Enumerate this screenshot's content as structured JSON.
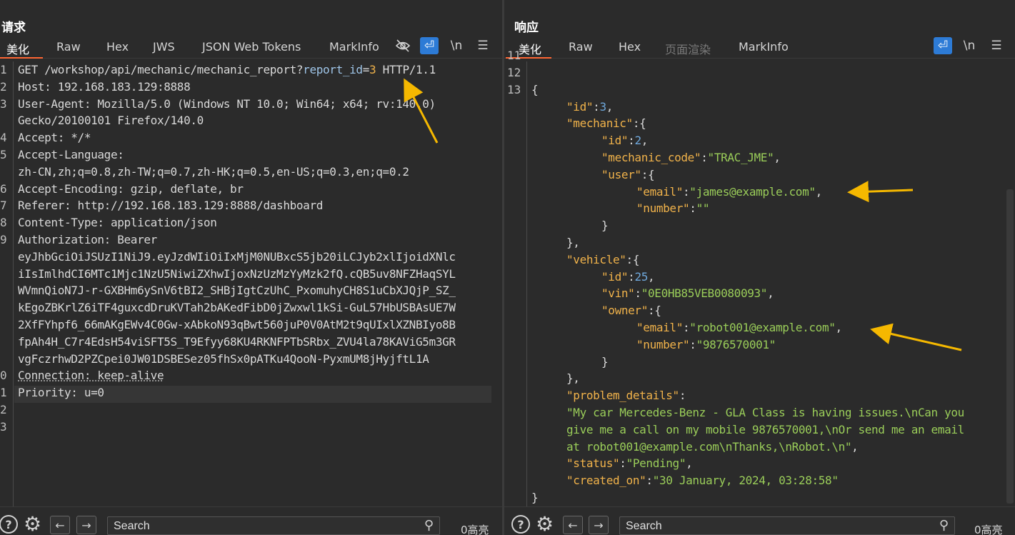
{
  "request": {
    "title": "请求",
    "tabs": [
      "美化",
      "Raw",
      "Hex",
      "JWS",
      "JSON Web Tokens",
      "MarkInfo"
    ],
    "tool_labels": {
      "wrap": "⏎",
      "newline": "\\n",
      "menu": "☰"
    },
    "line_numbers": [
      "1",
      "2",
      "3",
      "",
      "4",
      "5",
      "",
      "6",
      "7",
      "8",
      "9",
      "",
      "",
      "",
      "",
      "",
      "",
      "",
      "0",
      "1",
      "2",
      "3"
    ],
    "lines": [
      "GET /workshop/api/mechanic/mechanic_report?",
      "Host: 192.168.183.129:8888",
      "User-Agent: Mozilla/5.0 (Windows NT 10.0; Win64; x64; rv:140.0)",
      "Gecko/20100101 Firefox/140.0",
      "Accept: */*",
      "Accept-Language:",
      "zh-CN,zh;q=0.8,zh-TW;q=0.7,zh-HK;q=0.5,en-US;q=0.3,en;q=0.2",
      "Accept-Encoding: gzip, deflate, br",
      "Referer: http://192.168.183.129:8888/dashboard",
      "Content-Type: application/json",
      "Authorization: Bearer",
      "eyJhbGciOiJSUzI1NiJ9.eyJzdWIiOiIxMjM0NUBxcS5jb20iLCJyb2xlIjoidXNlc",
      "iIsImlhdCI6MTc1Mjc1NzU5NiwiZXhwIjoxNzUzMzYyMzk2fQ.cQB5uv8NFZHaqSYL",
      "WVmnQioN7J-r-GXBHm6ySnV6tBI2_SHBjIgtCzUhC_PxomuhyCH8S1uCbXJQjP_SZ_",
      "kEgoZBKrlZ6iTF4guxcdDruKVTah2bAKedFibD0jZwxwl1kSi-GuL57HbUSBAsUE7W",
      "2XfFYhpf6_66mAKgEWv4C0Gw-xAbkoN93qBwt560juP0V0AtM2t9qUIxlXZNBIyo8B",
      "fpAh4H_C7r4EdsH54viSFT5S_T9Efyy68KU4RKNFPTbSRbx_ZVU4la78KAViG5m3GR",
      "vgFczrhwD2PZCpei0JW01DSBESez05fhSx0pATKu4QooN-PyxmUM8jHyjftL1A",
      "Connection: keep-alive",
      "Priority: u=0"
    ],
    "param_name": "report_id",
    "param_eq": "=",
    "param_value": "3",
    "line1_tail": " HTTP/1.1"
  },
  "response": {
    "title": "响应",
    "tabs": [
      "美化",
      "Raw",
      "Hex",
      "页面渲染",
      "MarkInfo"
    ],
    "tool_labels": {
      "wrap": "⏎",
      "newline": "\\n",
      "menu": "☰"
    },
    "line_numbers": [
      "11",
      "12",
      "13"
    ],
    "json_lines": [
      {
        "indent": 0,
        "parts": [
          [
            "p",
            "{"
          ]
        ]
      },
      {
        "indent": 1,
        "parts": [
          [
            "k",
            "\"id\""
          ],
          [
            "p",
            ":"
          ],
          [
            "n",
            "3"
          ],
          [
            "p",
            ","
          ]
        ]
      },
      {
        "indent": 1,
        "parts": [
          [
            "k",
            "\"mechanic\""
          ],
          [
            "p",
            ":{"
          ]
        ]
      },
      {
        "indent": 2,
        "parts": [
          [
            "k",
            "\"id\""
          ],
          [
            "p",
            ":"
          ],
          [
            "n",
            "2"
          ],
          [
            "p",
            ","
          ]
        ]
      },
      {
        "indent": 2,
        "parts": [
          [
            "k",
            "\"mechanic_code\""
          ],
          [
            "p",
            ":"
          ],
          [
            "s",
            "\"TRAC_JME\""
          ],
          [
            "p",
            ","
          ]
        ]
      },
      {
        "indent": 2,
        "parts": [
          [
            "k",
            "\"user\""
          ],
          [
            "p",
            ":{"
          ]
        ]
      },
      {
        "indent": 3,
        "parts": [
          [
            "k",
            "\"email\""
          ],
          [
            "p",
            ":"
          ],
          [
            "s",
            "\"james@example.com\""
          ],
          [
            "p",
            ","
          ]
        ]
      },
      {
        "indent": 3,
        "parts": [
          [
            "k",
            "\"number\""
          ],
          [
            "p",
            ":"
          ],
          [
            "s",
            "\"\""
          ]
        ]
      },
      {
        "indent": 2,
        "parts": [
          [
            "p",
            "}"
          ]
        ]
      },
      {
        "indent": 1,
        "parts": [
          [
            "p",
            "},"
          ]
        ]
      },
      {
        "indent": 1,
        "parts": [
          [
            "k",
            "\"vehicle\""
          ],
          [
            "p",
            ":{"
          ]
        ]
      },
      {
        "indent": 2,
        "parts": [
          [
            "k",
            "\"id\""
          ],
          [
            "p",
            ":"
          ],
          [
            "n",
            "25"
          ],
          [
            "p",
            ","
          ]
        ]
      },
      {
        "indent": 2,
        "parts": [
          [
            "k",
            "\"vin\""
          ],
          [
            "p",
            ":"
          ],
          [
            "s",
            "\"0E0HB85VEB0080093\""
          ],
          [
            "p",
            ","
          ]
        ]
      },
      {
        "indent": 2,
        "parts": [
          [
            "k",
            "\"owner\""
          ],
          [
            "p",
            ":{"
          ]
        ]
      },
      {
        "indent": 3,
        "parts": [
          [
            "k",
            "\"email\""
          ],
          [
            "p",
            ":"
          ],
          [
            "s",
            "\"robot001@example.com\""
          ],
          [
            "p",
            ","
          ]
        ]
      },
      {
        "indent": 3,
        "parts": [
          [
            "k",
            "\"number\""
          ],
          [
            "p",
            ":"
          ],
          [
            "s",
            "\"9876570001\""
          ]
        ]
      },
      {
        "indent": 2,
        "parts": [
          [
            "p",
            "}"
          ]
        ]
      },
      {
        "indent": 1,
        "parts": [
          [
            "p",
            "},"
          ]
        ]
      },
      {
        "indent": 1,
        "parts": [
          [
            "k",
            "\"problem_details\""
          ],
          [
            "p",
            ":"
          ]
        ]
      },
      {
        "indent": 1,
        "parts": [
          [
            "s",
            "\"My car Mercedes-Benz - GLA Class is having issues.\\nCan you"
          ]
        ]
      },
      {
        "indent": 1,
        "parts": [
          [
            "s",
            "give me a call on my mobile 9876570001,\\nOr send me an email"
          ]
        ]
      },
      {
        "indent": 1,
        "parts": [
          [
            "s",
            "at robot001@example.com\\nThanks,\\nRobot.\\n\""
          ],
          [
            "p",
            ","
          ]
        ]
      },
      {
        "indent": 1,
        "parts": [
          [
            "k",
            "\"status\""
          ],
          [
            "p",
            ":"
          ],
          [
            "s",
            "\"Pending\""
          ],
          [
            "p",
            ","
          ]
        ]
      },
      {
        "indent": 1,
        "parts": [
          [
            "k",
            "\"created_on\""
          ],
          [
            "p",
            ":"
          ],
          [
            "s",
            "\"30 January, 2024, 03:28:58\""
          ]
        ]
      },
      {
        "indent": 0,
        "parts": [
          [
            "p",
            "}"
          ]
        ]
      }
    ]
  },
  "bottom": {
    "search_placeholder": "Search",
    "highlight_count": "0高亮"
  },
  "colors": {
    "accent_tab": "#ff6633",
    "active_button": "#2d7bd6",
    "arrow": "#f5b800"
  }
}
